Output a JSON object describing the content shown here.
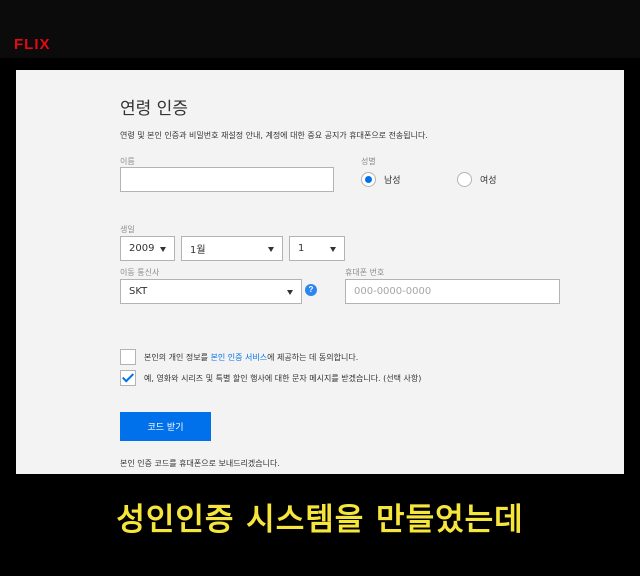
{
  "header": {
    "logo_text": "FLIX"
  },
  "form": {
    "title": "연령 인증",
    "description": "연령 및 본인 인증과 비밀번호 재설정 안내, 계정에 대한 중요 공지가 휴대폰으로 전송됩니다.",
    "name": {
      "label": "이름",
      "value": ""
    },
    "gender": {
      "label": "성별",
      "male": "남성",
      "female": "여성",
      "selected": "남성"
    },
    "birth": {
      "label": "생일",
      "year": "2009",
      "month": "1월",
      "day": "1"
    },
    "carrier": {
      "label": "이동 통신사",
      "value": "SKT",
      "help": "?"
    },
    "phone": {
      "label": "휴대폰 번호",
      "placeholder": "000-0000-0000"
    },
    "consent": {
      "checked": false,
      "prefix": "본인의 개인 정보를 ",
      "link": "본인 인증 서비스",
      "suffix": "에 제공하는 데 동의합니다."
    },
    "marketing": {
      "checked": true,
      "text": "예, 영화와 시리즈 및 특별 할인 행사에 대한 문자 메시지를 받겠습니다. (선택 사항)"
    },
    "submit_label": "코드 받기",
    "footnote": "본인 인증 코드를 휴대폰으로 보내드리겠습니다."
  },
  "caption": {
    "text": "성인인증 시스템을 만들었는데"
  },
  "colors": {
    "accent": "#0071eb",
    "logo": "#e50914",
    "caption": "#f6e63b"
  }
}
